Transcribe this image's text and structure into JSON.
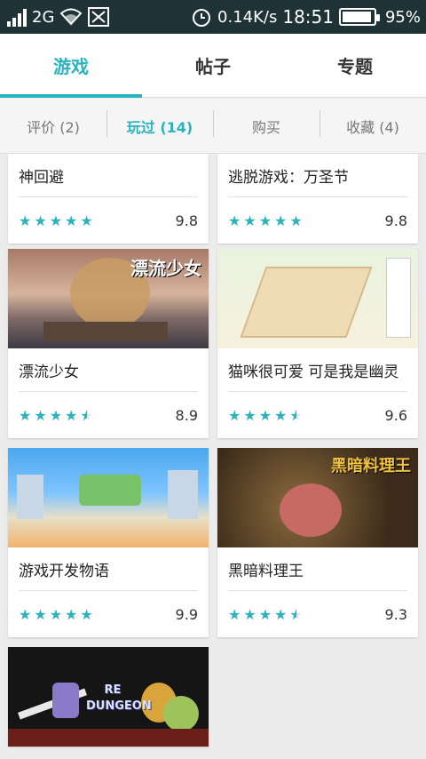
{
  "status_bar": {
    "network": "2G",
    "speed": "0.14K/s",
    "time": "18:51",
    "battery": "95%",
    "battery_level": 0.95
  },
  "tabs": [
    {
      "label": "游戏",
      "active": true
    },
    {
      "label": "帖子",
      "active": false
    },
    {
      "label": "专题",
      "active": false
    }
  ],
  "subtabs": [
    {
      "label": "评价 (2)",
      "active": false
    },
    {
      "label": "玩过 (14)",
      "active": true
    },
    {
      "label": "购买",
      "active": false
    },
    {
      "label": "收藏 (4)",
      "active": false
    }
  ],
  "cards": [
    {
      "title": "神回避",
      "score": "9.8",
      "stars": 5
    },
    {
      "title": "逃脱游戏：万圣节",
      "score": "9.8",
      "stars": 5
    },
    {
      "title": "漂流少女",
      "score": "8.9",
      "stars": 4.5,
      "image_text": "漂流少女"
    },
    {
      "title": "猫咪很可爱 可是我是幽灵",
      "score": "9.6",
      "stars": 4.8
    },
    {
      "title": "游戏开发物语",
      "score": "9.9",
      "stars": 5
    },
    {
      "title": "黑暗料理王",
      "score": "9.3",
      "stars": 4.7,
      "image_text": "黑暗料理王"
    },
    {
      "title": "",
      "score": "",
      "stars": 0,
      "image_text": "RE DUNGEON"
    }
  ],
  "colors": {
    "accent": "#29b3be",
    "status_bar": "#1f3336"
  }
}
